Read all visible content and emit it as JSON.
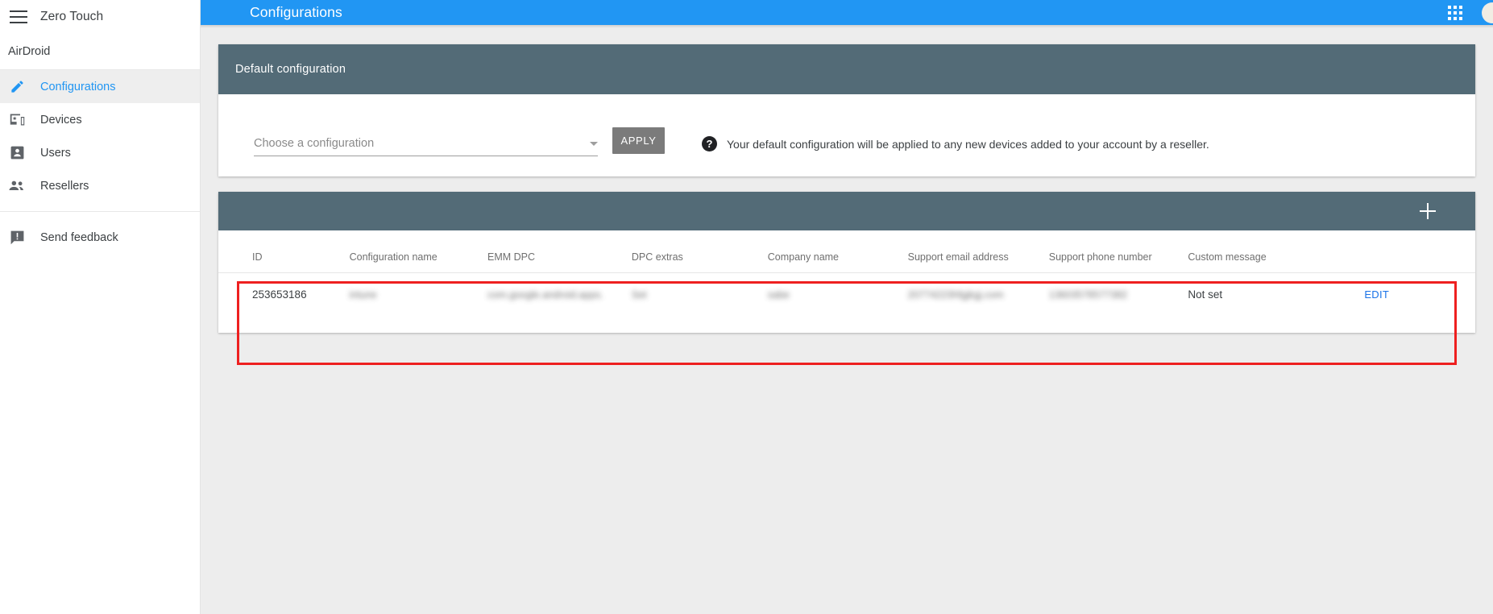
{
  "sidebar": {
    "menu_icon": "hamburger-icon",
    "product_title": "Zero Touch",
    "account_name": "AirDroid",
    "items": [
      {
        "label": "Configurations",
        "icon": "pencil-icon",
        "active": true
      },
      {
        "label": "Devices",
        "icon": "devices-icon",
        "active": false
      },
      {
        "label": "Users",
        "icon": "person-icon",
        "active": false
      },
      {
        "label": "Resellers",
        "icon": "people-icon",
        "active": false
      }
    ],
    "feedback": {
      "label": "Send feedback",
      "icon": "feedback-icon"
    }
  },
  "topbar": {
    "title": "Configurations",
    "apps_icon": "apps-grid-icon",
    "avatar": "user-avatar",
    "background": "#2196f3"
  },
  "default_card": {
    "header_title": "Default configuration",
    "select_placeholder": "Choose a configuration",
    "select_value": "",
    "dropdown_icon": "chevron-down-icon",
    "apply_label": "APPLY",
    "help_icon": "help-question-icon",
    "hint": "Your default configuration will be applied to any new devices added to your account by a reseller.",
    "header_background": "#536b77"
  },
  "table_card": {
    "add_icon": "plus-icon",
    "header_background": "#536b77",
    "highlight_color": "#ee2020",
    "columns": [
      "ID",
      "Configuration name",
      "EMM DPC",
      "DPC extras",
      "Company name",
      "Support email address",
      "Support phone number",
      "Custom message",
      ""
    ],
    "rows": [
      {
        "id": "253653186",
        "configuration_name": "intune",
        "emm_dpc": "com.google.android.apps.",
        "dpc_extras": "Set",
        "company_name": "sabe",
        "support_email": "20774223hfgjkgj.com",
        "support_phone": "13603578577382",
        "custom_message": "Not set",
        "action_label": "EDIT"
      }
    ]
  }
}
